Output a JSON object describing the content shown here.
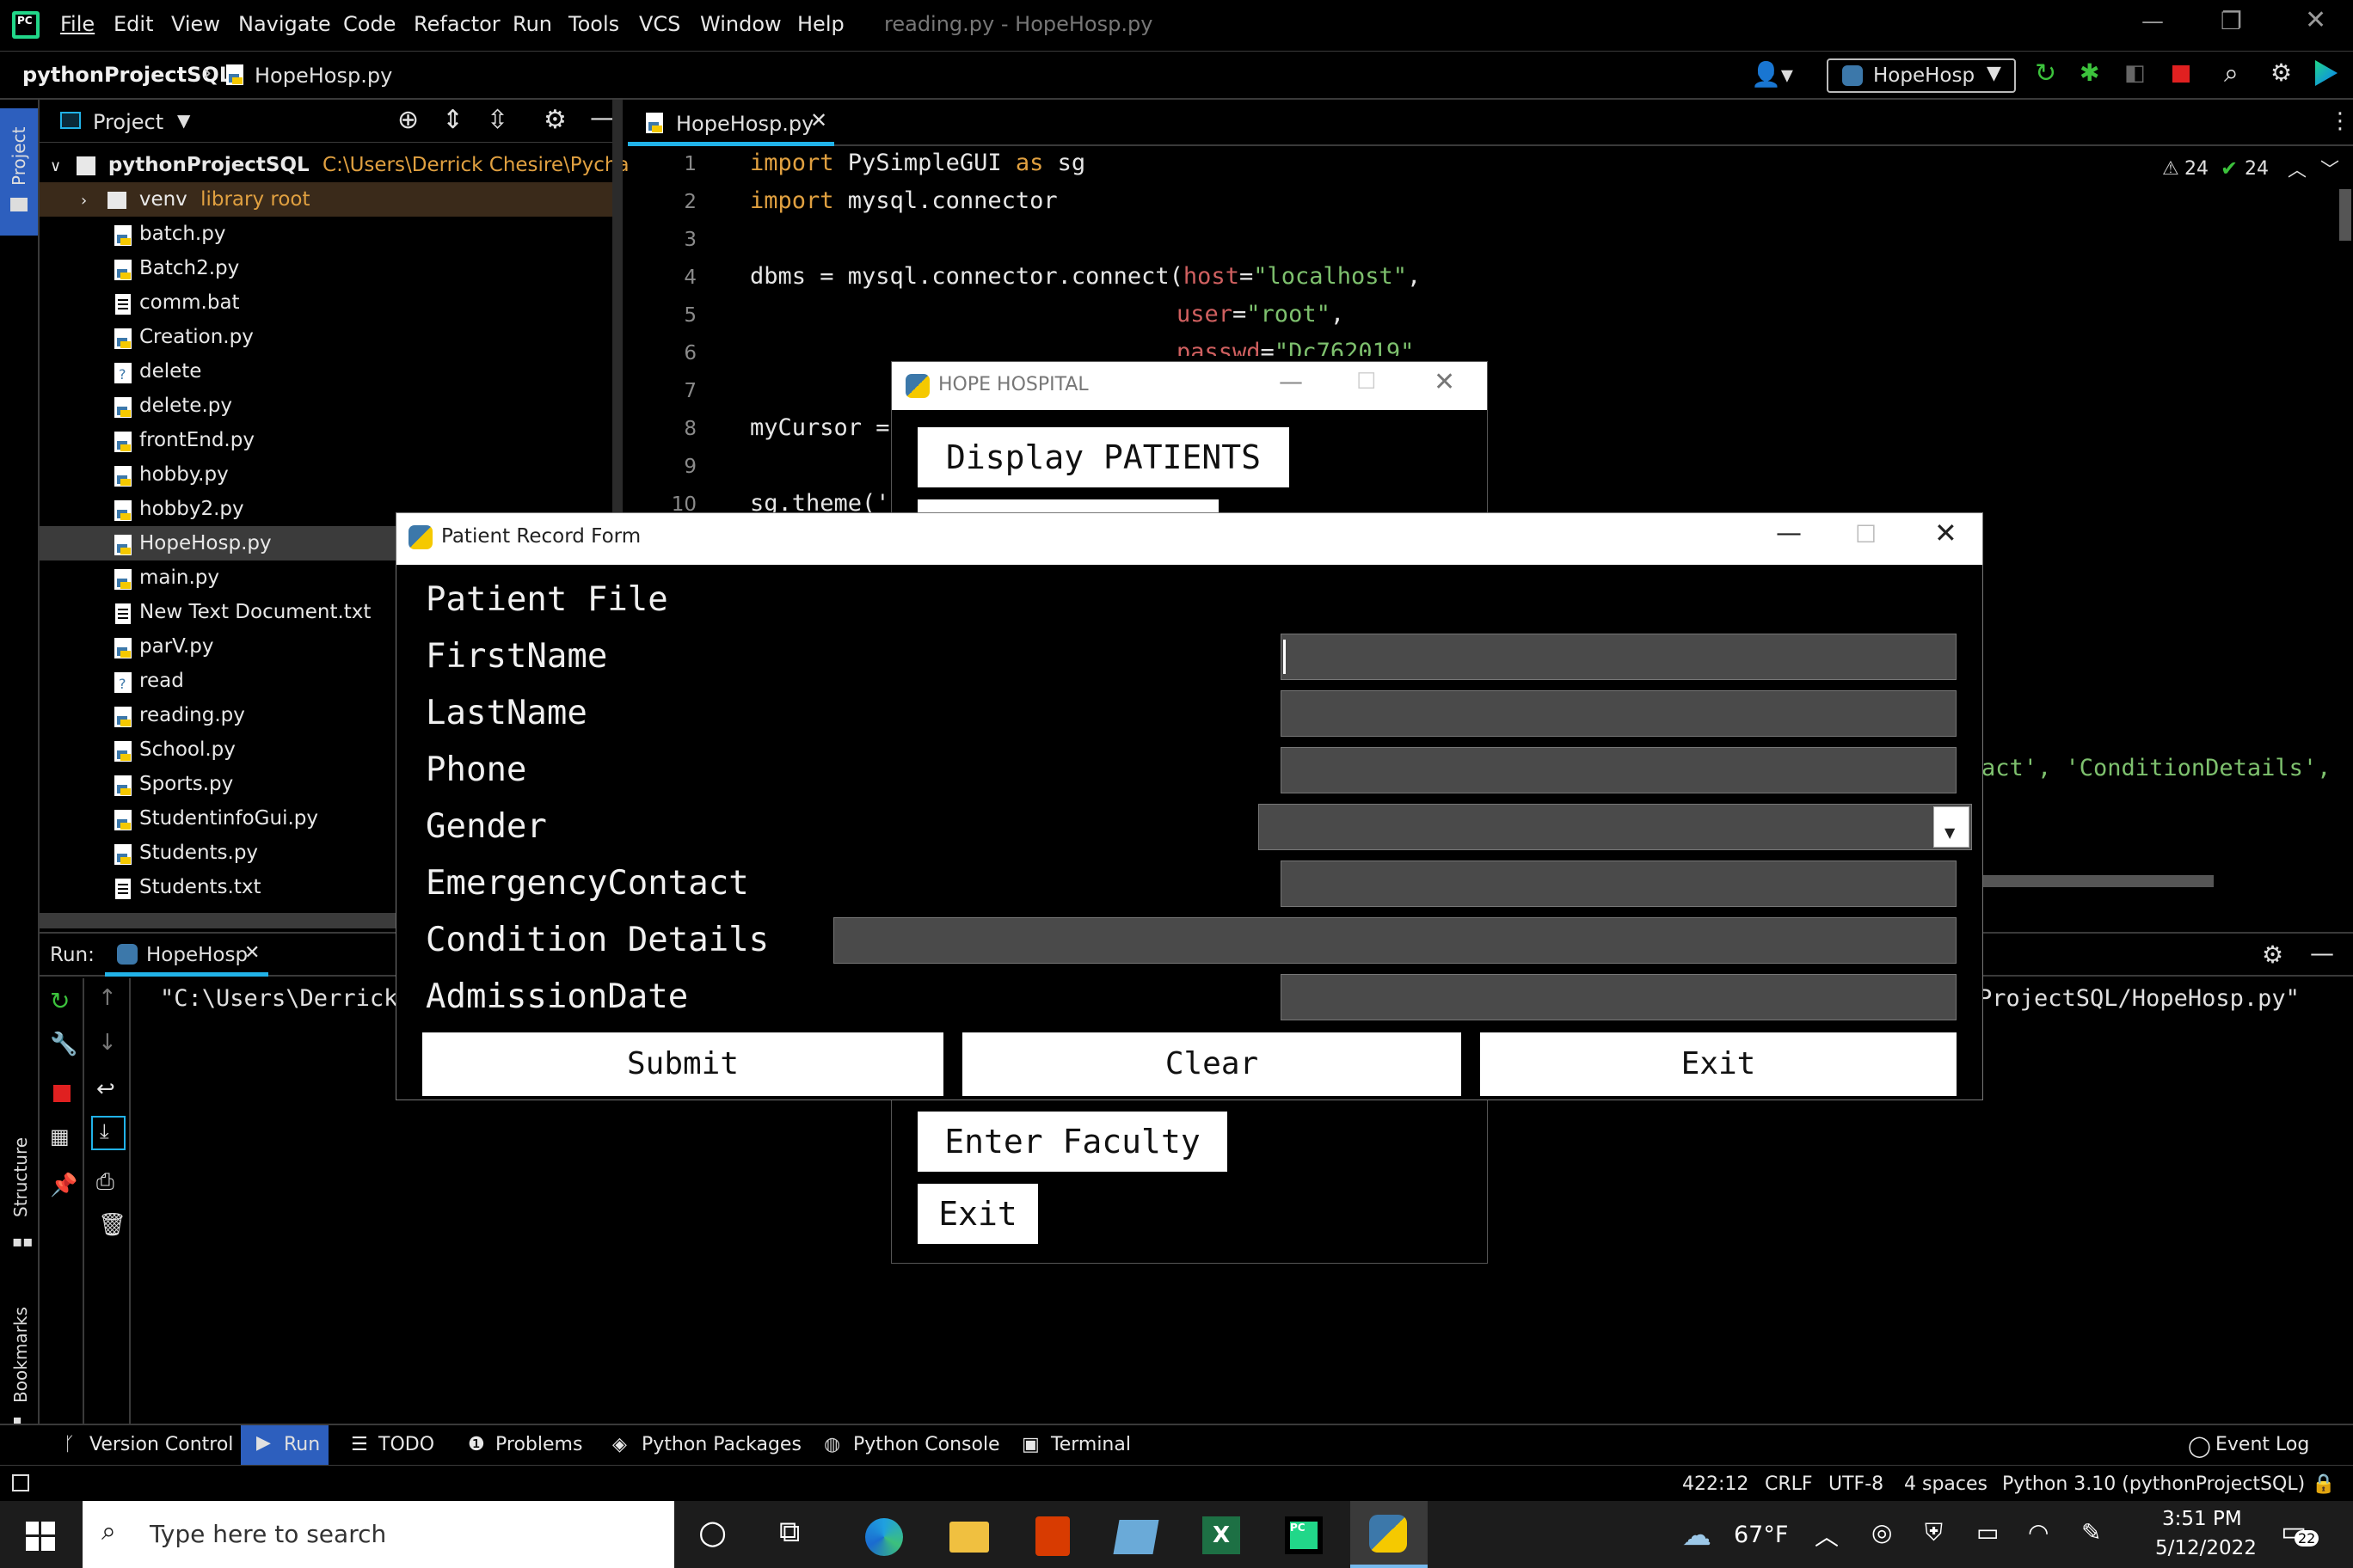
{
  "ide": {
    "menu": [
      "File",
      "Edit",
      "View",
      "Navigate",
      "Code",
      "Refactor",
      "Run",
      "Tools",
      "VCS",
      "Window",
      "Help"
    ],
    "window_title": "reading.py - HopeHosp.py",
    "breadcrumb_project": "pythonProjectSQL",
    "breadcrumb_file": "HopeHosp.py",
    "run_config": "HopeHosp",
    "project_tool_label": "Project",
    "project_panel_title": "Project",
    "project_root": "pythonProjectSQL",
    "project_root_path": "C:\\Users\\Derrick Chesire\\PycharmI",
    "venv_label": "venv",
    "venv_note": "library root",
    "files": [
      "batch.py",
      "Batch2.py",
      "comm.bat",
      "Creation.py",
      "delete",
      "delete.py",
      "frontEnd.py",
      "hobby.py",
      "hobby2.py",
      "HopeHosp.py",
      "main.py",
      "New Text Document.txt",
      "parV.py",
      "read",
      "reading.py",
      "School.py",
      "Sports.py",
      "StudentinfoGui.py",
      "Students.py",
      "Students.txt"
    ],
    "selected_file": "HopeHosp.py",
    "editor_tab": "HopeHosp.py",
    "warnings_count": "24",
    "ok_count": "24",
    "code": {
      "l1_kw1": "import",
      "l1_rest": " PySimpleGUI ",
      "l1_kw2": "as",
      "l1_alias": " sg",
      "l2_kw": "import",
      "l2_rest": " mysql.connector",
      "l4_pre": "dbms = mysql.connector.connect(",
      "l4_param": "host",
      "l4_eq": "=",
      "l4_str": "\"localhost\"",
      "l4_end": ",",
      "l5_param": "user",
      "l5_eq": "=",
      "l5_str": "\"root\"",
      "l5_end": ",",
      "l6_param": "passwd",
      "l6_eq": "=",
      "l6_str": "\"Dc762019\"",
      "l8": "myCursor =",
      "l10": "sg.theme('",
      "right_frag": "act', 'ConditionDetails',"
    },
    "line_numbers": [
      "1",
      "2",
      "3",
      "4",
      "5",
      "6",
      "7",
      "8",
      "9",
      "10"
    ],
    "run_label": "Run:",
    "run_tab": "HopeHosp",
    "run_output_left": "\"C:\\Users\\Derrick",
    "run_output_right": "ProjectSQL/HopeHosp.py\"",
    "side_structure": "Structure",
    "side_bookmarks": "Bookmarks",
    "bottom_tabs": [
      "Version Control",
      "Run",
      "TODO",
      "Problems",
      "Python Packages",
      "Python Console",
      "Terminal"
    ],
    "event_log": "Event Log",
    "status": {
      "pos": "422:12",
      "eol": "CRLF",
      "enc": "UTF-8",
      "indent": "4 spaces",
      "interp": "Python 3.10 (pythonProjectSQL)"
    }
  },
  "hope_window": {
    "title": "HOPE HOSPITAL",
    "btn_display": "Display PATIENTS",
    "btn_faculty": "Enter Faculty",
    "btn_exit": "Exit"
  },
  "form": {
    "title": "Patient Record Form",
    "heading": "Patient File",
    "labels": [
      "FirstName",
      "LastName",
      "Phone",
      "Gender",
      "EmergencyContact",
      "Condition Details",
      "AdmissionDate"
    ],
    "values": [
      "",
      "",
      "",
      "",
      "",
      "",
      ""
    ],
    "submit": "Submit",
    "clear": "Clear",
    "exit": "Exit"
  },
  "taskbar": {
    "search_placeholder": "Type here to search",
    "temp": "67°F",
    "time": "3:51 PM",
    "date": "5/12/2022",
    "notif": "22"
  },
  "colors": {
    "accent": "#21b2e8",
    "selected_row": "#3b3b3b",
    "venv_row": "#3a2a1a",
    "orange": "#e0a040",
    "green_str": "#7ec16e"
  }
}
